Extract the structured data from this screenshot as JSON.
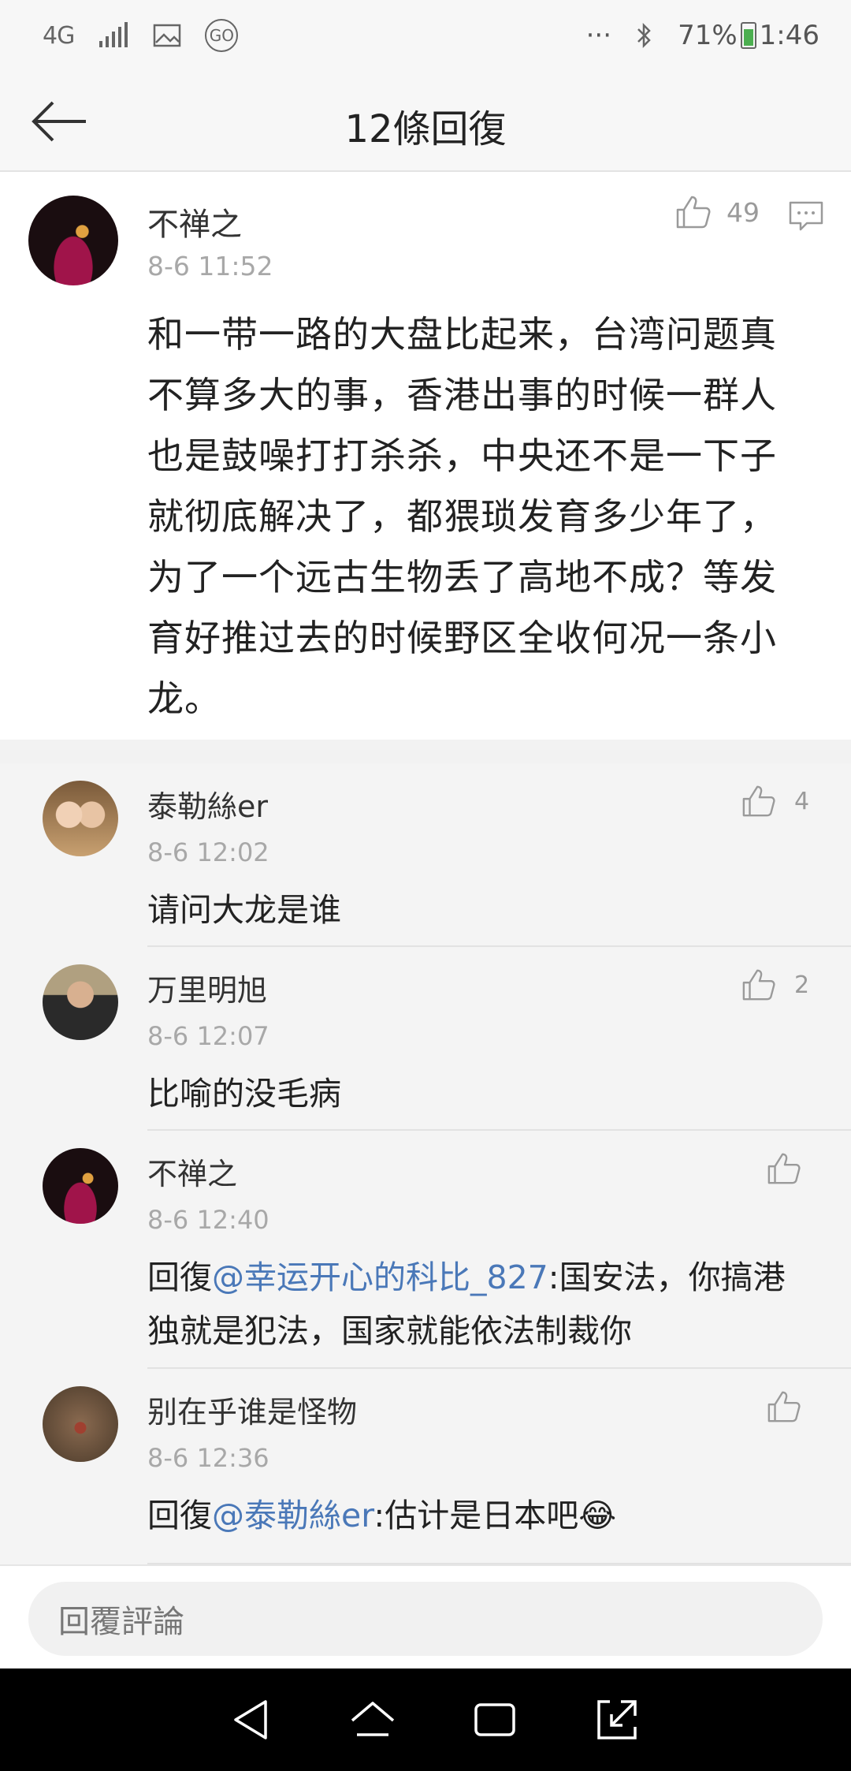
{
  "status_bar": {
    "network": "4G",
    "dots": "···",
    "battery": "71%",
    "time": "1:46",
    "go_label": "GO"
  },
  "header": {
    "title": "12條回復"
  },
  "main_comment": {
    "author": "不禅之",
    "time": "8-6 11:52",
    "likes": "49",
    "text": "和一带一路的大盘比起来，台湾问题真不算多大的事，香港出事的时候一群人也是鼓噪打打杀杀，中央还不是一下子就彻底解决了，都猥琐发育多少年了，为了一个远古生物丢了高地不成？等发育好推过去的时候野区全收何况一条小龙。"
  },
  "replies": [
    {
      "author": "泰勒絲er",
      "time": "8-6 12:02",
      "likes": "4",
      "text": "请问大龙是谁"
    },
    {
      "author": "万里明旭",
      "time": "8-6 12:07",
      "likes": "2",
      "text": "比喻的没毛病"
    },
    {
      "author": "不禅之",
      "time": "8-6 12:40",
      "likes": "",
      "prefix": "回復",
      "mention": "@幸运开心的科比_827",
      "text": ":国安法，你搞港独就是犯法，国家就能依法制裁你"
    },
    {
      "author": "别在乎谁是怪物",
      "time": "8-6 12:36",
      "likes": "",
      "prefix": "回復",
      "mention": "@泰勒絲er",
      "text": ":估计是日本吧😂"
    }
  ],
  "input": {
    "placeholder": "回覆評論"
  },
  "colors": {
    "mention": "#4a78b8",
    "meta": "#a8a8a8"
  }
}
